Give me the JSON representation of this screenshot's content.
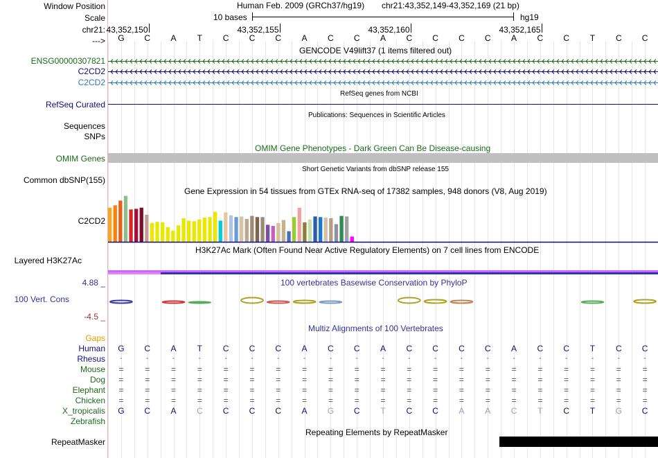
{
  "header": {
    "window_position_label": "Window Position",
    "scale_label": "Scale",
    "chrom_label": "chr21:",
    "arrow_label": "--->",
    "assembly": "Human Feb. 2009 (GRCh37/hg19)",
    "position": "chr21:43,352,149-43,352,169 (21 bp)",
    "scale_text": "10 bases",
    "db": "hg19",
    "ticks": [
      "43,352,150",
      "43,352,155",
      "43,352,160",
      "43,352,165"
    ]
  },
  "sequence": [
    "G",
    "C",
    "A",
    "T",
    "C",
    "C",
    "C",
    "A",
    "C",
    "C",
    "A",
    "C",
    "C",
    "C",
    "C",
    "A",
    "C",
    "C",
    "T",
    "C",
    "C"
  ],
  "tracks": {
    "gencode": {
      "title": "GENCODE V49lift37 (1 items filtered out)",
      "items": [
        "ENSG00000307821",
        "C2CD2",
        "C2CD2"
      ]
    },
    "refseq": {
      "title": "RefSeq genes from NCBI",
      "label": "RefSeq Curated"
    },
    "publications": {
      "title": "Publications: Sequences in Scientific Articles",
      "labels": [
        "Sequences",
        "SNPs"
      ]
    },
    "omim": {
      "title": "OMIM Gene Phenotypes - Dark Green Can Be Disease-causing",
      "label": "OMIM Genes"
    },
    "dbsnp": {
      "title": "Short Genetic Variants from dbSNP release 155",
      "label": "Common dbSNP(155)"
    },
    "gtex": {
      "title": "Gene Expression in 54 tissues from GTEx RNA-seq of 17382 samples, 948 donors (V8, Aug 2019)",
      "label": "C2CD2"
    },
    "h3k27ac": {
      "title": "H3K27Ac Mark (Often Found Near Active Regulatory Elements) on 7 cell lines from ENCODE",
      "label": "Layered H3K27Ac"
    },
    "phylop": {
      "title": "100 vertebrates Basewise Conservation by PhyloP",
      "label": "100 Vert. Cons",
      "max": "4.88 _",
      "min": "-4.5 _"
    },
    "multiz": {
      "title": "Multiz Alignments of 100 Vertebrates",
      "gaps_label": "Gaps",
      "species": [
        {
          "name": "Human",
          "row": [
            "G",
            "C",
            "A",
            "T",
            "C",
            "C",
            "C",
            "A",
            "C",
            "C",
            "A",
            "C",
            "C",
            "C",
            "C",
            "A",
            "C",
            "C",
            "T",
            "C",
            "C"
          ]
        },
        {
          "name": "Rhesus",
          "row": [
            "-",
            "-",
            "-",
            "-",
            "-",
            "-",
            "-",
            "-",
            "-",
            "-",
            "-",
            "-",
            "-",
            "-",
            "-",
            "-",
            "-",
            "-",
            "-",
            "-",
            "-"
          ]
        },
        {
          "name": "Mouse",
          "row": [
            "=",
            "=",
            "=",
            "=",
            "=",
            "=",
            "=",
            "=",
            "=",
            "=",
            "=",
            "=",
            "=",
            "=",
            "=",
            "=",
            "=",
            "=",
            "=",
            "=",
            "="
          ]
        },
        {
          "name": "Dog",
          "row": [
            "=",
            "=",
            "=",
            "=",
            "=",
            "=",
            "=",
            "=",
            "=",
            "=",
            "=",
            "=",
            "=",
            "=",
            "=",
            "=",
            "=",
            "=",
            "=",
            "=",
            "="
          ]
        },
        {
          "name": "Elephant",
          "row": [
            "=",
            "=",
            "=",
            "=",
            "=",
            "=",
            "=",
            "=",
            "=",
            "=",
            "=",
            "=",
            "=",
            "=",
            "=",
            "=",
            "=",
            "=",
            "=",
            "=",
            "="
          ]
        },
        {
          "name": "Chicken",
          "row": [
            "=",
            "=",
            "=",
            "=",
            "=",
            "=",
            "=",
            "=",
            "=",
            "=",
            "=",
            "=",
            "=",
            "=",
            "=",
            "=",
            "=",
            "=",
            "=",
            "=",
            "="
          ]
        },
        {
          "name": "X_tropicalis",
          "row": [
            "G",
            "C",
            "A",
            "C",
            "C",
            "C",
            "C",
            "A",
            "G",
            "C",
            "T",
            "C",
            "C",
            "A",
            "A",
            "C",
            "T",
            "C",
            "T",
            "G",
            "C"
          ]
        },
        {
          "name": "Zebrafish",
          "row": []
        }
      ]
    },
    "repeatmasker": {
      "title": "Repeating Elements by RepeatMasker",
      "label": "RepeatMasker"
    }
  },
  "gtex_bars": [
    {
      "v": 0.58,
      "c": "#f5a623"
    },
    {
      "v": 0.62,
      "c": "#ff7f0e"
    },
    {
      "v": 0.7,
      "c": "#e85f1a"
    },
    {
      "v": 0.78,
      "c": "#8fbc8f"
    },
    {
      "v": 0.55,
      "c": "#d62728"
    },
    {
      "v": 0.56,
      "c": "#a50f3a"
    },
    {
      "v": 0.58,
      "c": "#7b0f2a"
    },
    {
      "v": 0.46,
      "c": "#c49c94"
    },
    {
      "v": 0.32,
      "c": "#e8e800"
    },
    {
      "v": 0.34,
      "c": "#e8e800"
    },
    {
      "v": 0.33,
      "c": "#e8e800"
    },
    {
      "v": 0.25,
      "c": "#e8e800"
    },
    {
      "v": 0.19,
      "c": "#e8e800"
    },
    {
      "v": 0.28,
      "c": "#e8e800"
    },
    {
      "v": 0.4,
      "c": "#e8e800"
    },
    {
      "v": 0.36,
      "c": "#e8e800"
    },
    {
      "v": 0.35,
      "c": "#e8e800"
    },
    {
      "v": 0.38,
      "c": "#e8e800"
    },
    {
      "v": 0.41,
      "c": "#e8e800"
    },
    {
      "v": 0.42,
      "c": "#e8e800"
    },
    {
      "v": 0.51,
      "c": "#e8e800"
    },
    {
      "v": 0.36,
      "c": "#00ced1"
    },
    {
      "v": 0.5,
      "c": "#e6c8a0"
    },
    {
      "v": 0.45,
      "c": "#b0c4de"
    },
    {
      "v": 0.42,
      "c": "#6a9bd8"
    },
    {
      "v": 0.43,
      "c": "#d4c4a8"
    },
    {
      "v": 0.39,
      "c": "#bca88e"
    },
    {
      "v": 0.44,
      "c": "#a08c70"
    },
    {
      "v": 0.42,
      "c": "#7a6550"
    },
    {
      "v": 0.42,
      "c": "#9a8a76"
    },
    {
      "v": 0.29,
      "c": "#7b4f9d"
    },
    {
      "v": 0.27,
      "c": "#c060c0"
    },
    {
      "v": 0.32,
      "c": "#d4bf9a"
    },
    {
      "v": 0.37,
      "c": "#c4b08a"
    },
    {
      "v": 0.18,
      "c": "#4b6cb7"
    },
    {
      "v": 0.42,
      "c": "#9acd32"
    },
    {
      "v": 0.58,
      "c": "#f0a0a0"
    },
    {
      "v": 0.33,
      "c": "#8b7d3a"
    },
    {
      "v": 0.38,
      "c": "#c0e0b0"
    },
    {
      "v": 0.43,
      "c": "#2a5caa"
    },
    {
      "v": 0.42,
      "c": "#1f77d4"
    },
    {
      "v": 0.41,
      "c": "#d4c0a8"
    },
    {
      "v": 0.4,
      "c": "#b49c86"
    },
    {
      "v": 0.3,
      "c": "#9090a0"
    },
    {
      "v": 0.44,
      "c": "#2e8b57"
    },
    {
      "v": 0.43,
      "c": "#a0a0a8"
    },
    {
      "v": 0.09,
      "c": "#ff00ff"
    }
  ],
  "colors": {
    "gencode_green": "#1a6b1a",
    "navy": "#0c0c78",
    "teal": "#2e7ab8",
    "omim_gray": "#c0c0c0",
    "grid": "#e6e6e6",
    "left_border": "#f0b0b0",
    "h3k27ac_purple": "#cc66ff",
    "phylop_blue": "#333399",
    "phylop_red": "#993333",
    "gaps_orange": "#e69900"
  }
}
